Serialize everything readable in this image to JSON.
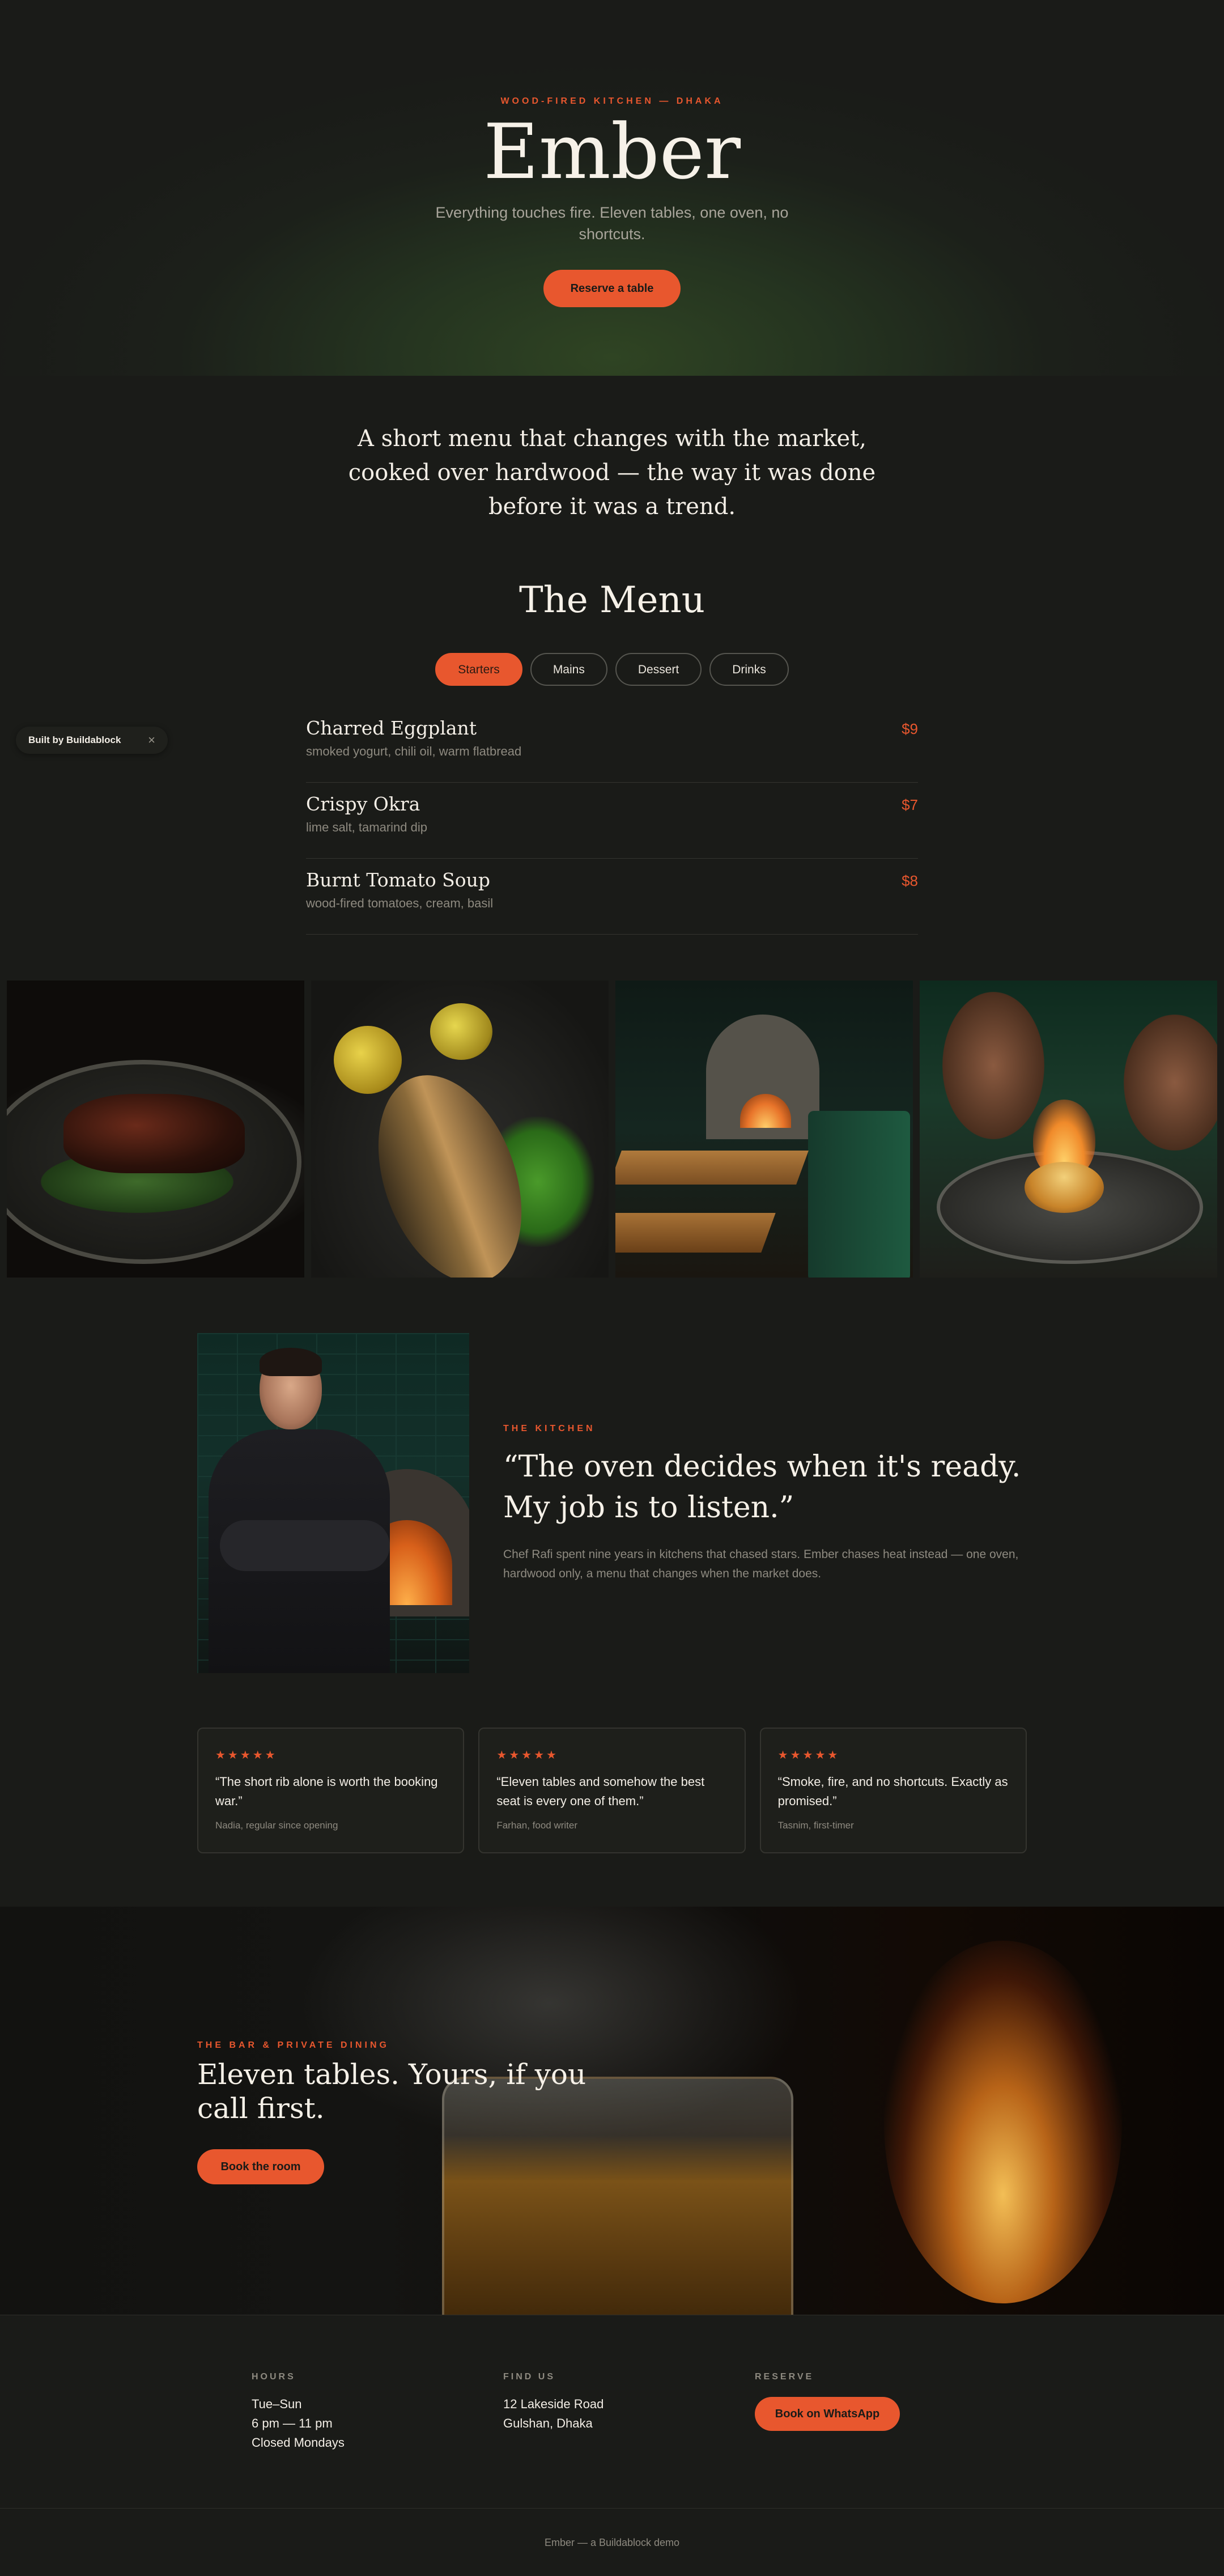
{
  "hero": {
    "eyebrow": "WOOD-FIRED KITCHEN — DHAKA",
    "title": "Ember",
    "subtitle": "Everything touches fire. Eleven tables, one oven, no shortcuts.",
    "cta": "Reserve a table"
  },
  "intro": "A short menu that changes with the market, cooked over hardwood — the way it was done before it was a trend.",
  "menu": {
    "title": "The Menu",
    "tabs": [
      "Starters",
      "Mains",
      "Dessert",
      "Drinks"
    ],
    "active_tab": "Starters",
    "items": [
      {
        "name": "Charred Eggplant",
        "desc": "smoked yogurt, chili oil, warm flatbread",
        "price": "$9"
      },
      {
        "name": "Crispy Okra",
        "desc": "lime salt, tamarind dip",
        "price": "$7"
      },
      {
        "name": "Burnt Tomato Soup",
        "desc": "wood-fired tomatoes, cream, basil",
        "price": "$8"
      }
    ]
  },
  "badge": {
    "label": "Built by Buildablock",
    "close": "×"
  },
  "kitchen": {
    "eyebrow": "THE KITCHEN",
    "quote": "“The oven decides when it's ready. My job is to listen.”",
    "body": "Chef Rafi spent nine years in kitchens that chased stars. Ember chases heat instead — one oven, hardwood only, a menu that changes when the market does."
  },
  "reviews": [
    {
      "stars": "★★★★★",
      "quote": "“The short rib alone is worth the booking war.”",
      "who": "Nadia, regular since opening"
    },
    {
      "stars": "★★★★★",
      "quote": "“Eleven tables and somehow the best seat is every one of them.”",
      "who": "Farhan, food writer"
    },
    {
      "stars": "★★★★★",
      "quote": "“Smoke, fire, and no shortcuts. Exactly as promised.”",
      "who": "Tasnim, first-timer"
    }
  ],
  "bar": {
    "eyebrow": "THE BAR & PRIVATE DINING",
    "title": "Eleven tables. Yours, if you call first.",
    "cta": "Book the room"
  },
  "footer": {
    "hours": {
      "label": "HOURS",
      "lines": [
        "Tue–Sun",
        "6 pm — 11 pm",
        "Closed Mondays"
      ]
    },
    "find": {
      "label": "FIND US",
      "lines": [
        "12 Lakeside Road",
        "Gulshan, Dhaka"
      ]
    },
    "reserve": {
      "label": "RESERVE",
      "cta": "Book on WhatsApp"
    },
    "copyright": "Ember — a Buildablock demo"
  },
  "colors": {
    "accent": "#e8572e",
    "background": "#1a1b18",
    "text": "#f3eee6",
    "muted": "#8e8a80"
  }
}
